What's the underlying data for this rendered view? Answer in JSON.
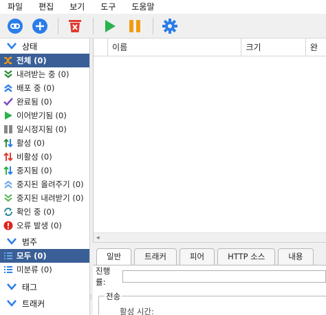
{
  "menu": [
    "파일",
    "편집",
    "보기",
    "도구",
    "도움말"
  ],
  "toolbar": {
    "buttons": [
      {
        "name": "add-link-button",
        "icon": "link-icon"
      },
      {
        "name": "add-torrent-button",
        "icon": "plus-icon"
      },
      {
        "name": "remove-button",
        "icon": "delete-icon"
      },
      {
        "name": "resume-button",
        "icon": "play-icon"
      },
      {
        "name": "pause-button",
        "icon": "pause-icon"
      },
      {
        "name": "options-button",
        "icon": "gear-icon"
      }
    ],
    "colors": {
      "blue": "#2b7de9",
      "red": "#e03a2f",
      "green": "#2bb24c",
      "orange": "#f39c12"
    }
  },
  "sidebar": {
    "status_header": "상태",
    "status_items": [
      {
        "label": "전체 (0)",
        "icon": "shuffle-icon",
        "selected": true
      },
      {
        "label": "내려받는 중 (0)",
        "icon": "downloading-icon"
      },
      {
        "label": "배포 중 (0)",
        "icon": "seeding-icon"
      },
      {
        "label": "완료됨 (0)",
        "icon": "completed-icon"
      },
      {
        "label": "이어받기됨 (0)",
        "icon": "resumed-icon"
      },
      {
        "label": "일시정지됨 (0)",
        "icon": "paused-icon"
      },
      {
        "label": "활성 (0)",
        "icon": "active-icon"
      },
      {
        "label": "비활성 (0)",
        "icon": "inactive-icon"
      },
      {
        "label": "중지됨 (0)",
        "icon": "stopped-icon"
      },
      {
        "label": "중지된 올려주기 (0)",
        "icon": "stalled-upload-icon"
      },
      {
        "label": "중지된 내려받기 (0)",
        "icon": "stalled-download-icon"
      },
      {
        "label": "확인 중 (0)",
        "icon": "checking-icon"
      },
      {
        "label": "오류 발생 (0)",
        "icon": "error-icon"
      }
    ],
    "category_header": "범주",
    "category_items": [
      {
        "label": "모두 (0)",
        "icon": "list-icon",
        "selected": true
      },
      {
        "label": "미분류 (0)",
        "icon": "list-icon"
      }
    ],
    "tags_header": "태그",
    "trackers_header": "트래커"
  },
  "table": {
    "columns": [
      "",
      "이름",
      "크기",
      "완"
    ]
  },
  "details": {
    "tabs": [
      "일반",
      "트래커",
      "피어",
      "HTTP 소스",
      "내용"
    ],
    "active_tab": 0,
    "progress_label": "진행률:",
    "progress": 0,
    "transfer_group": "전송",
    "transfer_sub": "활성 시간:"
  }
}
